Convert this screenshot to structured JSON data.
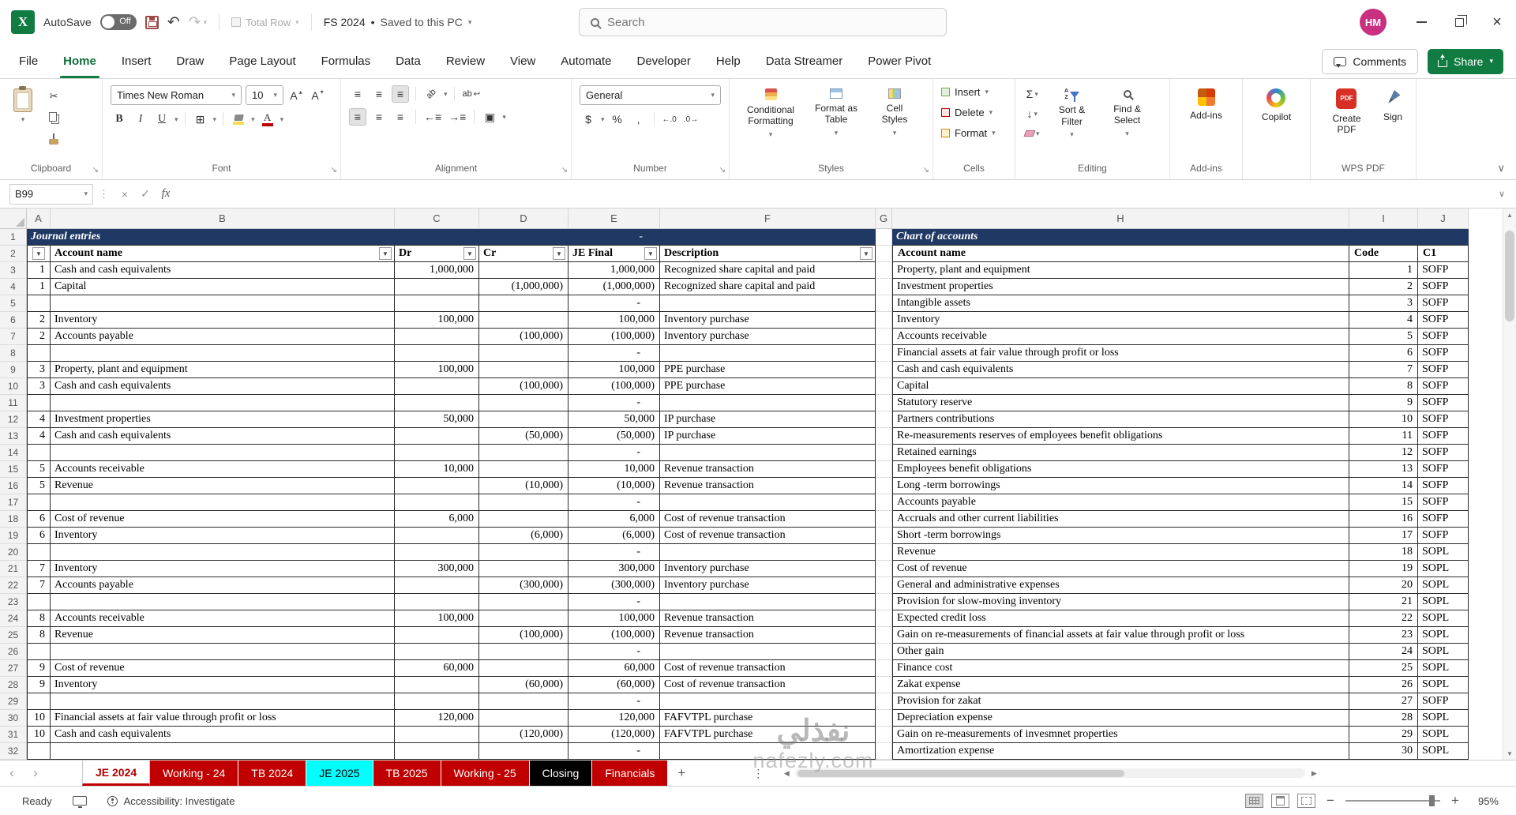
{
  "titlebar": {
    "autosave_label": "AutoSave",
    "autosave_state": "Off",
    "total_row": "Total Row",
    "doc_name": "FS 2024",
    "doc_separator": "•",
    "doc_status": "Saved to this PC",
    "search_placeholder": "Search",
    "avatar": "HM"
  },
  "ribbon": {
    "tabs": [
      "File",
      "Home",
      "Insert",
      "Draw",
      "Page Layout",
      "Formulas",
      "Data",
      "Review",
      "View",
      "Automate",
      "Developer",
      "Help",
      "Data Streamer",
      "Power Pivot"
    ],
    "active_tab": "Home",
    "comments": "Comments",
    "share": "Share",
    "font": {
      "name": "Times New Roman",
      "size": "10"
    },
    "number": {
      "format": "General"
    },
    "styles": {
      "conditional": "Conditional Formatting",
      "format_table": "Format as Table",
      "cell_styles": "Cell Styles"
    },
    "cells": {
      "insert": "Insert",
      "delete": "Delete",
      "format": "Format"
    },
    "editing": {
      "sort_filter": "Sort & Filter",
      "find_select": "Find & Select"
    },
    "addins": "Add-ins",
    "copilot": "Copilot",
    "wps": {
      "create_pdf": "Create PDF",
      "sign": "Sign"
    },
    "group_labels": {
      "clipboard": "Clipboard",
      "font": "Font",
      "alignment": "Alignment",
      "number": "Number",
      "styles": "Styles",
      "cells": "Cells",
      "editing": "Editing",
      "addins": "Add-ins",
      "wps": "WPS PDF"
    }
  },
  "formula_bar": {
    "name_box": "B99",
    "fx": "fx"
  },
  "grid": {
    "columns": [
      "A",
      "B",
      "C",
      "D",
      "E",
      "F",
      "G",
      "H",
      "I",
      "J"
    ],
    "row_count": 32
  },
  "journal": {
    "title": "Journal entries",
    "title_dash": "-",
    "headers": {
      "account": "Account name",
      "dr": "Dr",
      "cr": "Cr",
      "je": "JE Final",
      "desc": "Description"
    },
    "rows": [
      {
        "n": "1",
        "account": "Cash and cash equivalents",
        "dr": "1,000,000",
        "cr": "",
        "je": "1,000,000",
        "desc": "Recognized share capital  and paid"
      },
      {
        "n": "1",
        "account": "Capital",
        "dr": "",
        "cr": "(1,000,000)",
        "je": "(1,000,000)",
        "desc": "Recognized share capital  and paid"
      },
      {
        "n": "",
        "account": "",
        "dr": "",
        "cr": "",
        "je": "-",
        "desc": "",
        "spacer": true
      },
      {
        "n": "2",
        "account": "Inventory",
        "dr": "100,000",
        "cr": "",
        "je": "100,000",
        "desc": "Inventory purchase"
      },
      {
        "n": "2",
        "account": "Accounts payable",
        "dr": "",
        "cr": "(100,000)",
        "je": "(100,000)",
        "desc": "Inventory purchase"
      },
      {
        "n": "",
        "account": "",
        "dr": "",
        "cr": "",
        "je": "-",
        "desc": "",
        "spacer": true
      },
      {
        "n": "3",
        "account": "Property, plant and equipment",
        "dr": "100,000",
        "cr": "",
        "je": "100,000",
        "desc": "PPE purchase"
      },
      {
        "n": "3",
        "account": "Cash and cash equivalents",
        "dr": "",
        "cr": "(100,000)",
        "je": "(100,000)",
        "desc": "PPE purchase"
      },
      {
        "n": "",
        "account": "",
        "dr": "",
        "cr": "",
        "je": "-",
        "desc": "",
        "spacer": true
      },
      {
        "n": "4",
        "account": "Investment properties",
        "dr": "50,000",
        "cr": "",
        "je": "50,000",
        "desc": "IP purchase"
      },
      {
        "n": "4",
        "account": "Cash and cash equivalents",
        "dr": "",
        "cr": "(50,000)",
        "je": "(50,000)",
        "desc": "IP purchase"
      },
      {
        "n": "",
        "account": "",
        "dr": "",
        "cr": "",
        "je": "-",
        "desc": "",
        "spacer": true
      },
      {
        "n": "5",
        "account": "Accounts receivable",
        "dr": "10,000",
        "cr": "",
        "je": "10,000",
        "desc": "Revenue transaction"
      },
      {
        "n": "5",
        "account": "Revenue",
        "dr": "",
        "cr": "(10,000)",
        "je": "(10,000)",
        "desc": "Revenue transaction"
      },
      {
        "n": "",
        "account": "",
        "dr": "",
        "cr": "",
        "je": "-",
        "desc": "",
        "spacer": true
      },
      {
        "n": "6",
        "account": "Cost of revenue",
        "dr": "6,000",
        "cr": "",
        "je": "6,000",
        "desc": "Cost of revenue transaction"
      },
      {
        "n": "6",
        "account": "Inventory",
        "dr": "",
        "cr": "(6,000)",
        "je": "(6,000)",
        "desc": "Cost of revenue transaction"
      },
      {
        "n": "",
        "account": "",
        "dr": "",
        "cr": "",
        "je": "-",
        "desc": "",
        "spacer": true
      },
      {
        "n": "7",
        "account": "Inventory",
        "dr": "300,000",
        "cr": "",
        "je": "300,000",
        "desc": "Inventory purchase"
      },
      {
        "n": "7",
        "account": "Accounts payable",
        "dr": "",
        "cr": "(300,000)",
        "je": "(300,000)",
        "desc": "Inventory purchase"
      },
      {
        "n": "",
        "account": "",
        "dr": "",
        "cr": "",
        "je": "-",
        "desc": "",
        "spacer": true
      },
      {
        "n": "8",
        "account": "Accounts receivable",
        "dr": "100,000",
        "cr": "",
        "je": "100,000",
        "desc": "Revenue transaction"
      },
      {
        "n": "8",
        "account": "Revenue",
        "dr": "",
        "cr": "(100,000)",
        "je": "(100,000)",
        "desc": "Revenue transaction"
      },
      {
        "n": "",
        "account": "",
        "dr": "",
        "cr": "",
        "je": "-",
        "desc": "",
        "spacer": true
      },
      {
        "n": "9",
        "account": "Cost of revenue",
        "dr": "60,000",
        "cr": "",
        "je": "60,000",
        "desc": "Cost of revenue transaction"
      },
      {
        "n": "9",
        "account": "Inventory",
        "dr": "",
        "cr": "(60,000)",
        "je": "(60,000)",
        "desc": "Cost of revenue transaction"
      },
      {
        "n": "",
        "account": "",
        "dr": "",
        "cr": "",
        "je": "-",
        "desc": "",
        "spacer": true
      },
      {
        "n": "10",
        "account": "Financial assets at fair value through profit or loss",
        "dr": "120,000",
        "cr": "",
        "je": "120,000",
        "desc": "FAFVTPL purchase"
      },
      {
        "n": "10",
        "account": "Cash and cash equivalents",
        "dr": "",
        "cr": "(120,000)",
        "je": "(120,000)",
        "desc": "FAFVTPL purchase"
      },
      {
        "n": "",
        "account": "",
        "dr": "",
        "cr": "",
        "je": "-",
        "desc": "",
        "spacer": true
      }
    ]
  },
  "chart": {
    "title": "Chart of accounts",
    "headers": {
      "name": "Account name",
      "code": "Code",
      "c1": "C1"
    },
    "rows": [
      {
        "name": "Property, plant and equipment",
        "code": "1",
        "c1": "SOFP"
      },
      {
        "name": "Investment properties",
        "code": "2",
        "c1": "SOFP"
      },
      {
        "name": "Intangible assets",
        "code": "3",
        "c1": "SOFP"
      },
      {
        "name": "Inventory",
        "code": "4",
        "c1": "SOFP"
      },
      {
        "name": "Accounts receivable",
        "code": "5",
        "c1": "SOFP"
      },
      {
        "name": "Financial assets at fair value through profit or loss",
        "code": "6",
        "c1": "SOFP"
      },
      {
        "name": "Cash and cash equivalents",
        "code": "7",
        "c1": "SOFP"
      },
      {
        "name": "Capital",
        "code": "8",
        "c1": "SOFP"
      },
      {
        "name": "Statutory reserve",
        "code": "9",
        "c1": "SOFP"
      },
      {
        "name": "Partners contributions",
        "code": "10",
        "c1": "SOFP"
      },
      {
        "name": "Re-measurements reserves of employees benefit obligations",
        "code": "11",
        "c1": "SOFP"
      },
      {
        "name": "Retained earnings",
        "code": "12",
        "c1": "SOFP"
      },
      {
        "name": "Employees benefit obligations",
        "code": "13",
        "c1": "SOFP"
      },
      {
        "name": "Long -term borrowings",
        "code": "14",
        "c1": "SOFP"
      },
      {
        "name": "Accounts payable",
        "code": "15",
        "c1": "SOFP"
      },
      {
        "name": "Accruals and other current liabilities",
        "code": "16",
        "c1": "SOFP"
      },
      {
        "name": "Short -term borrowings",
        "code": "17",
        "c1": "SOFP"
      },
      {
        "name": "Revenue",
        "code": "18",
        "c1": "SOPL"
      },
      {
        "name": "Cost of revenue",
        "code": "19",
        "c1": "SOPL"
      },
      {
        "name": "General and administrative expenses",
        "code": "20",
        "c1": "SOPL"
      },
      {
        "name": "Provision for slow-moving inventory",
        "code": "21",
        "c1": "SOPL"
      },
      {
        "name": "Expected credit loss",
        "code": "22",
        "c1": "SOPL"
      },
      {
        "name": "Gain on re-measurements of financial assets at fair value through profit or loss",
        "code": "23",
        "c1": "SOPL"
      },
      {
        "name": "Other gain",
        "code": "24",
        "c1": "SOPL"
      },
      {
        "name": "Finance cost",
        "code": "25",
        "c1": "SOPL"
      },
      {
        "name": "Zakat expense",
        "code": "26",
        "c1": "SOPL"
      },
      {
        "name": "Provision for zakat",
        "code": "27",
        "c1": "SOFP"
      },
      {
        "name": "Depreciation expense",
        "code": "28",
        "c1": "SOPL"
      },
      {
        "name": "Gain on re-measurements of invesmnet properties",
        "code": "29",
        "c1": "SOPL"
      },
      {
        "name": "Amortization expense",
        "code": "30",
        "c1": "SOPL"
      }
    ]
  },
  "sheet_tabs": [
    {
      "label": "JE 2024",
      "style": "active"
    },
    {
      "label": "Working - 24",
      "style": "red"
    },
    {
      "label": "TB 2024",
      "style": "red"
    },
    {
      "label": "JE 2025",
      "style": "cyan"
    },
    {
      "label": "TB 2025",
      "style": "red"
    },
    {
      "label": "Working - 25",
      "style": "red"
    },
    {
      "label": "Closing",
      "style": "black"
    },
    {
      "label": "Financials",
      "style": "red"
    }
  ],
  "status": {
    "ready": "Ready",
    "accessibility": "Accessibility: Investigate",
    "zoom": "95%"
  },
  "watermark": {
    "line1": "نفذلي",
    "line2": "nafezly.com"
  }
}
